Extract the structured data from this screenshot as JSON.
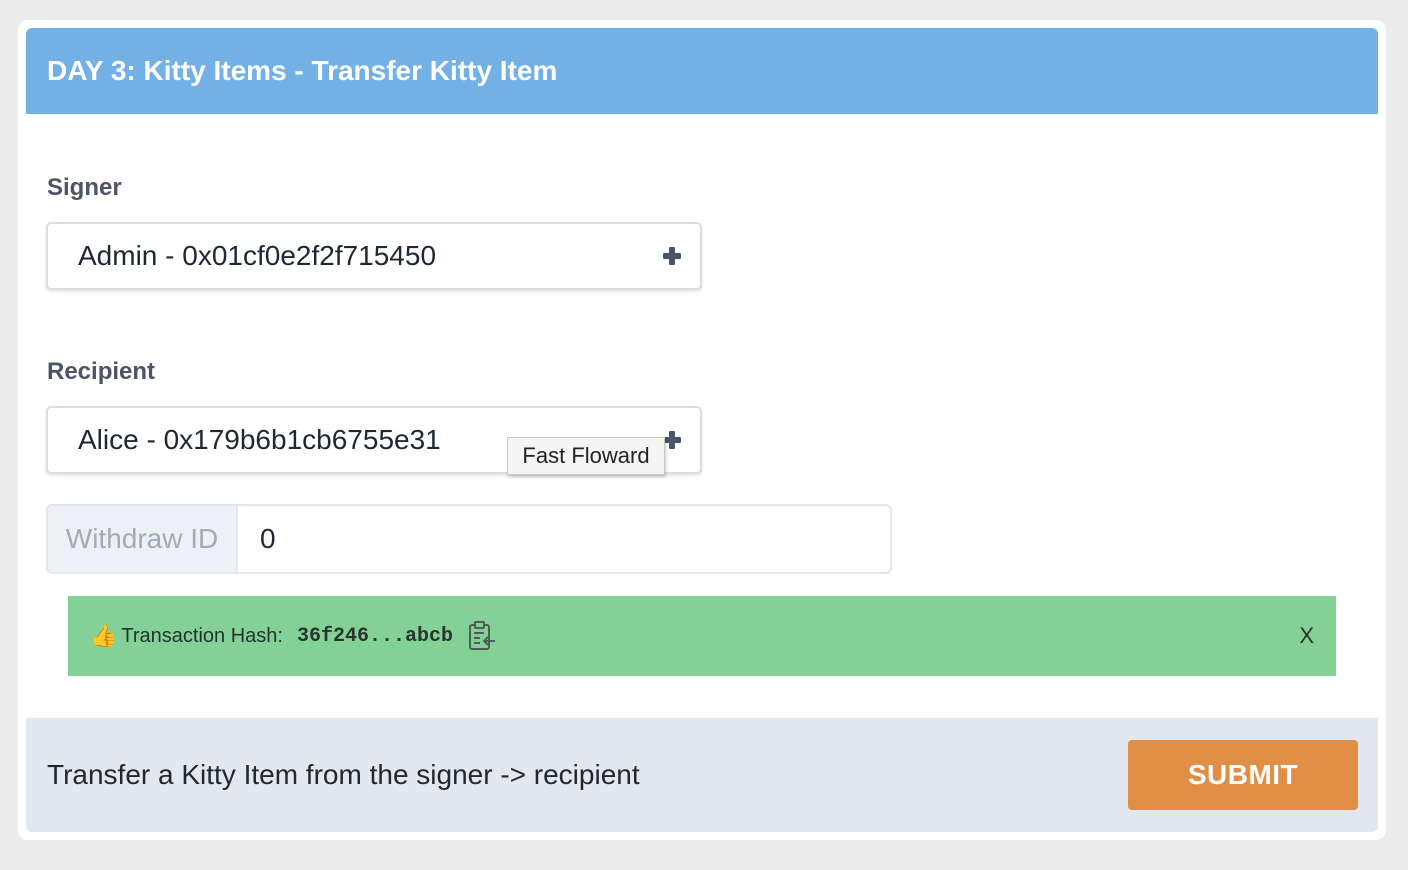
{
  "header": {
    "title": "DAY 3: Kitty Items - Transfer Kitty Item"
  },
  "signer": {
    "label": "Signer",
    "value": "Admin - 0x01cf0e2f2f715450",
    "icon": "plus-icon"
  },
  "recipient": {
    "label": "Recipient",
    "value": "Alice - 0x179b6b1cb6755e31",
    "icon": "plus-icon"
  },
  "tooltip": {
    "text": "Fast Floward"
  },
  "withdraw": {
    "addon_label": "Withdraw ID",
    "value": "0"
  },
  "alert": {
    "emoji": "👍",
    "label": "Transaction Hash:",
    "hash": "36f246...abcb",
    "copy_icon": "clipboard-icon",
    "close_label": "X",
    "color": "#84d198"
  },
  "footer": {
    "description": "Transfer a Kitty Item from the signer -> recipient",
    "submit_label": "SUBMIT"
  },
  "colors": {
    "header_bg": "#73b0e6",
    "submit_bg": "#e18e46",
    "footer_bg": "#e2e7f0"
  }
}
